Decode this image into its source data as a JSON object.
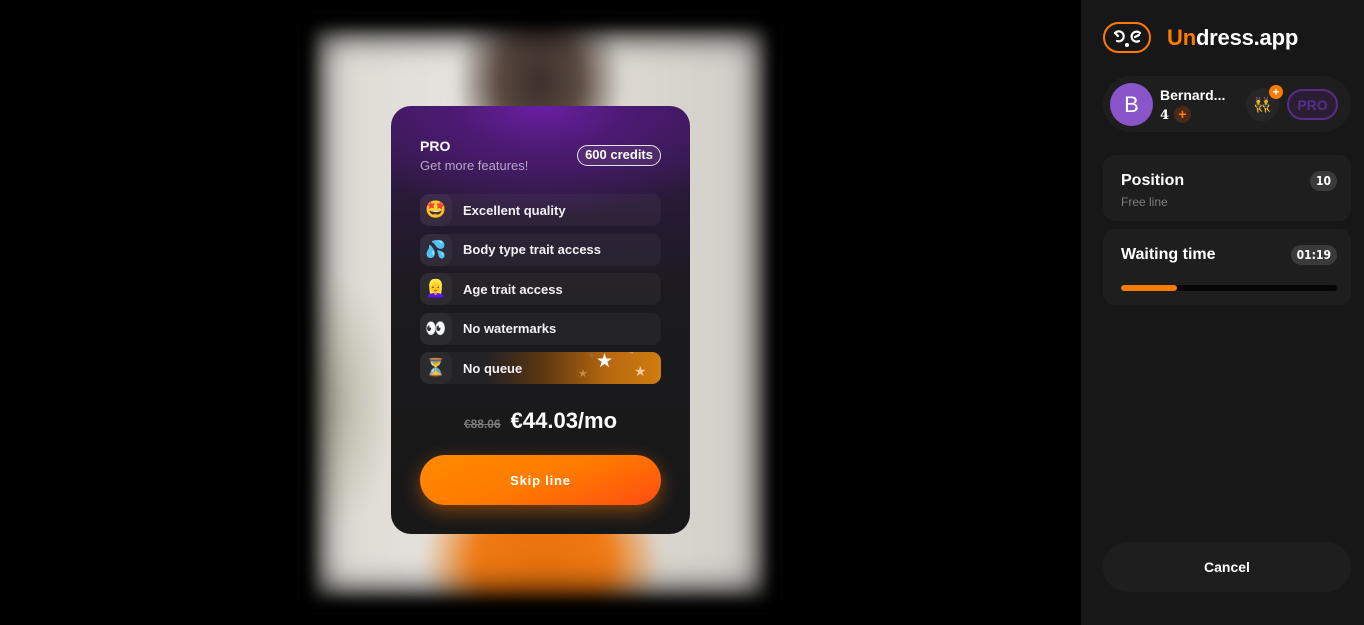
{
  "card": {
    "plan_name": "PRO",
    "plan_subtitle": "Get more features!",
    "credits_badge": "600 credits",
    "features": [
      {
        "icon": "star-struck-emoji",
        "glyph": "🤩",
        "label": "Excellent quality"
      },
      {
        "icon": "sweat-droplets-emoji",
        "glyph": "💦",
        "label": "Body type trait access"
      },
      {
        "icon": "woman-blond-emoji",
        "glyph": "👱‍♀️",
        "label": "Age trait access"
      },
      {
        "icon": "eyes-emoji",
        "glyph": "👀",
        "label": "No watermarks"
      },
      {
        "icon": "hourglass-emoji",
        "glyph": "⏳",
        "label": "No queue"
      }
    ],
    "price_old": "€88.06",
    "price_new": "€44.03/mo",
    "skip_button": "Skip line"
  },
  "sidebar": {
    "brand_accent": "Un",
    "brand_rest": "dress.app",
    "user": {
      "avatar_letter": "B",
      "name": "Bernard...",
      "credits": "4",
      "add_credits": "+",
      "couple_icon": "👯",
      "couple_plus": "+",
      "badge": "PRO"
    },
    "position": {
      "title": "Position",
      "subtitle": "Free line",
      "value": "10"
    },
    "waiting": {
      "title": "Waiting time",
      "value": "01:19",
      "progress_percent": 26
    },
    "cancel_button": "Cancel"
  },
  "colors": {
    "accent": "#ff7a00",
    "pro_purple": "#5b2a8a",
    "avatar": "#8a55c9",
    "sidebar_bg": "#171717"
  }
}
